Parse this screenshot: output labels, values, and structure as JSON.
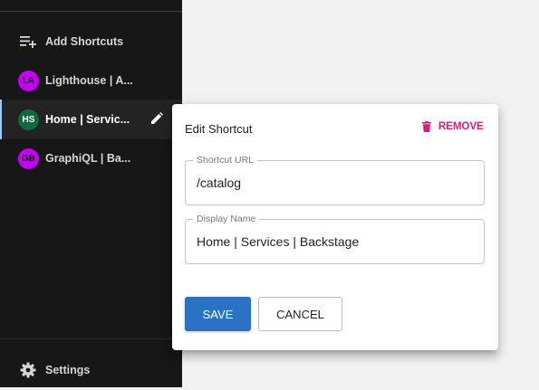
{
  "sidebar": {
    "add_shortcuts_label": "Add Shortcuts",
    "shortcuts": [
      {
        "initials": "LA",
        "label": "Lighthouse | A...",
        "avatar_color": "#c400f0"
      },
      {
        "initials": "HS",
        "label": "Home | Servic...",
        "avatar_color": "#0f6a3e"
      },
      {
        "initials": "GB",
        "label": "GraphiQL | Ba...",
        "avatar_color": "#c400f0"
      }
    ],
    "settings_label": "Settings"
  },
  "edit_shortcut": {
    "title": "Edit Shortcut",
    "remove_label": "REMOVE",
    "url_field": {
      "label": "Shortcut URL",
      "value": "/catalog"
    },
    "name_field": {
      "label": "Display Name",
      "value": "Home | Services | Backstage"
    },
    "save_label": "SAVE",
    "cancel_label": "CANCEL"
  },
  "colors": {
    "sidebar_bg": "#171717",
    "accent": "#2a72c4",
    "remove": "#e2187a",
    "active_indicator": "#9cc9ff"
  }
}
